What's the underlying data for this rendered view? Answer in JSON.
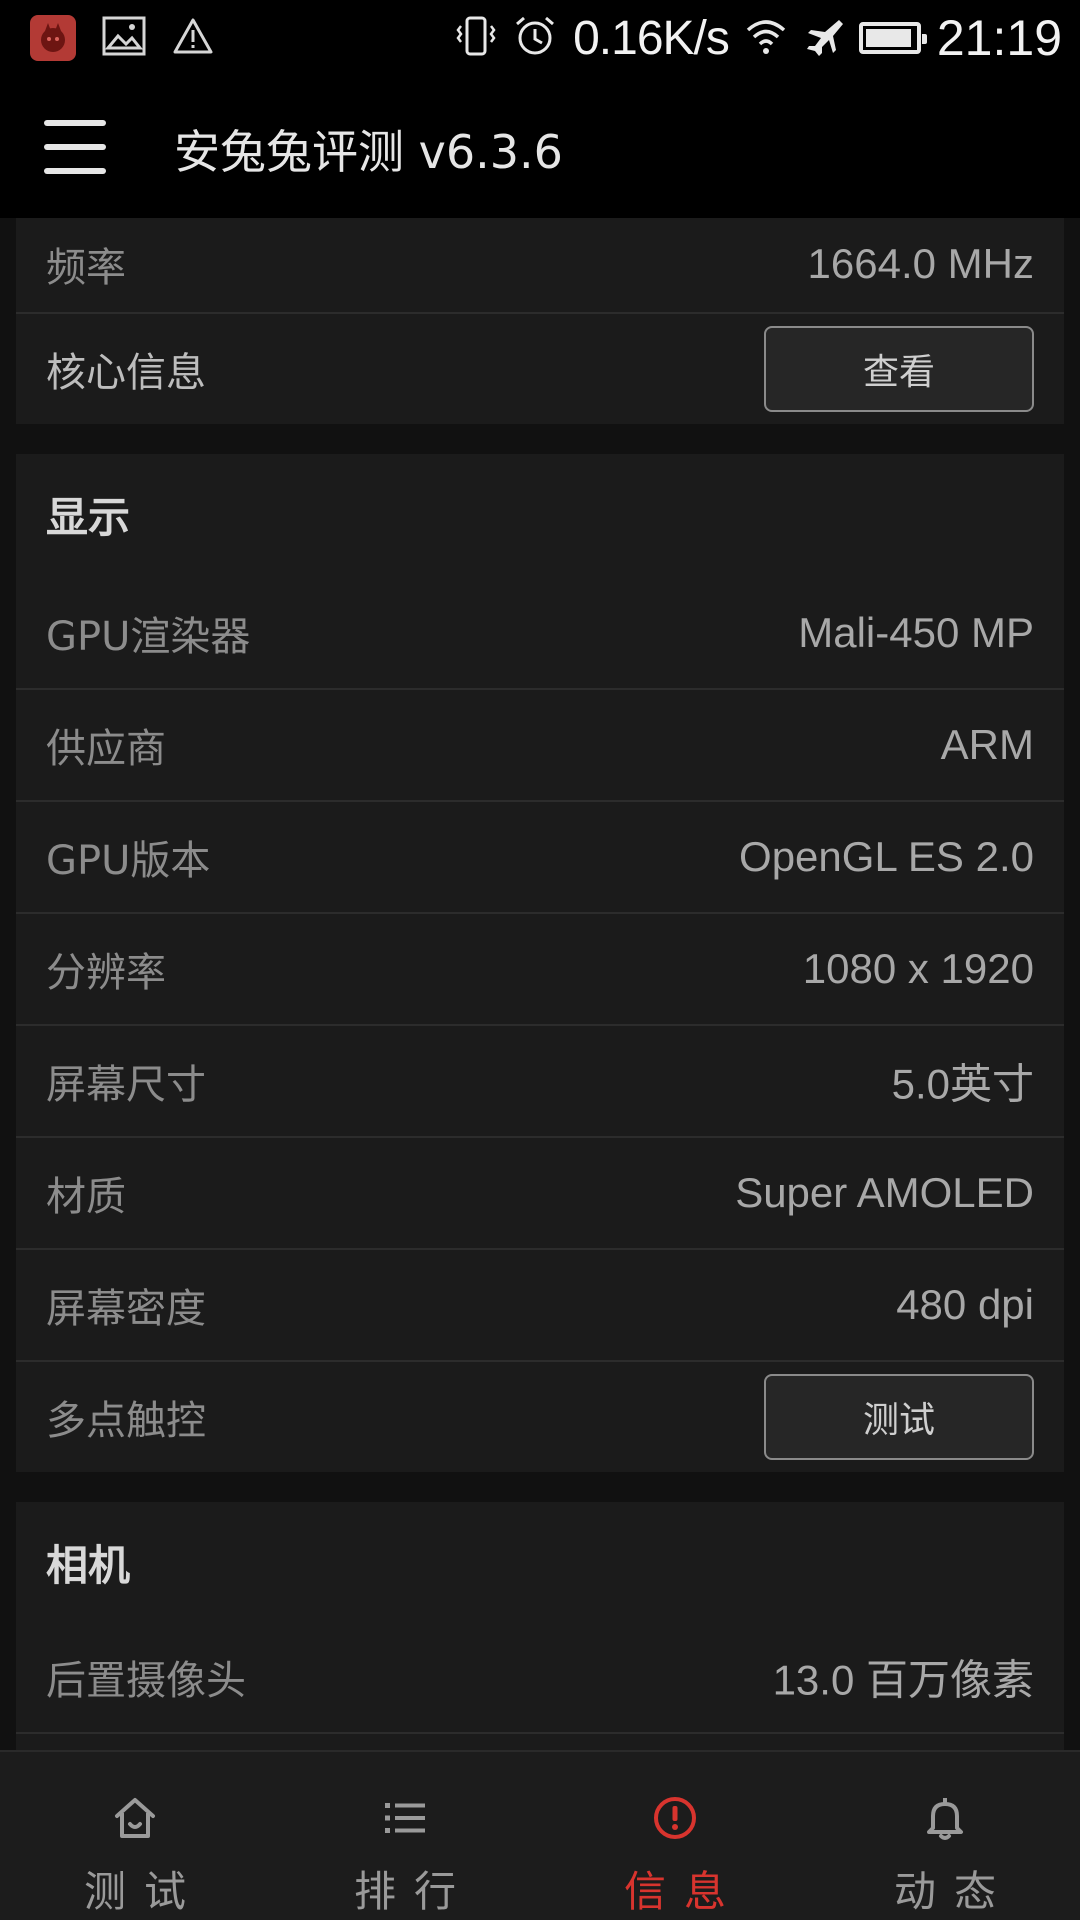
{
  "status_bar": {
    "network_speed": "0.16K/s",
    "time": "21:19",
    "battery_level": 0.95,
    "icons": [
      "app-icon",
      "image-icon",
      "warning-icon",
      "vibrate-icon",
      "alarm-icon",
      "wifi-icon",
      "airplane-icon",
      "battery-icon"
    ]
  },
  "app_bar": {
    "title": "安兔兔评测 v6.3.6"
  },
  "cpu_card": {
    "rows": [
      {
        "label": "频率",
        "value": "1664.0 MHz"
      },
      {
        "label": "核心信息",
        "button": "查看"
      }
    ]
  },
  "display_card": {
    "title": "显示",
    "rows": [
      {
        "label": "GPU渲染器",
        "value": "Mali-450 MP"
      },
      {
        "label": "供应商",
        "value": "ARM"
      },
      {
        "label": "GPU版本",
        "value": "OpenGL ES 2.0"
      },
      {
        "label": "分辨率",
        "value": "1080 x 1920"
      },
      {
        "label": "屏幕尺寸",
        "value": "5.0英寸"
      },
      {
        "label": "材质",
        "value": "Super AMOLED"
      },
      {
        "label": "屏幕密度",
        "value": "480 dpi"
      },
      {
        "label": "多点触控",
        "button": "测试"
      }
    ]
  },
  "camera_card": {
    "title": "相机",
    "rows": [
      {
        "label": "后置摄像头",
        "value": "13.0 百万像素"
      }
    ]
  },
  "bottom_nav": {
    "items": [
      {
        "label": "测试",
        "icon": "home-icon"
      },
      {
        "label": "排行",
        "icon": "list-icon"
      },
      {
        "label": "信息",
        "icon": "info-icon",
        "active": true
      },
      {
        "label": "动态",
        "icon": "bell-icon"
      }
    ],
    "active_color": "#d8342e"
  }
}
